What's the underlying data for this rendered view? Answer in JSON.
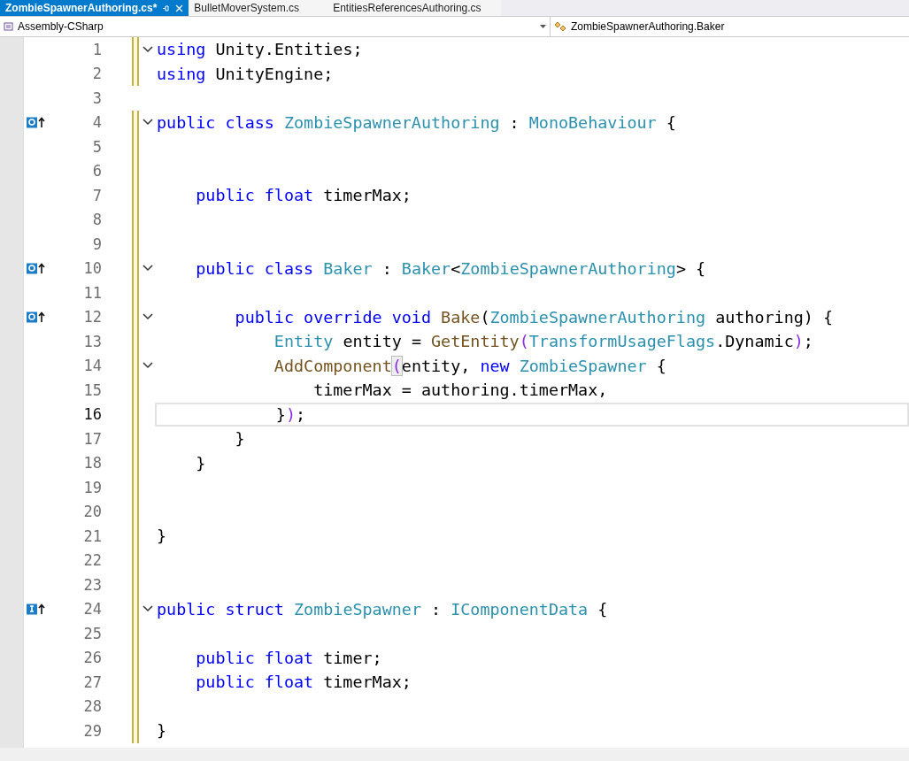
{
  "tabs": [
    {
      "label": "ZombieSpawnerAuthoring.cs*",
      "selected": true
    },
    {
      "label": "BulletMoverSystem.cs",
      "selected": false
    },
    {
      "label": "EntitiesReferencesAuthoring.cs",
      "selected": false
    }
  ],
  "navigation": {
    "project": "Assembly-CSharp",
    "member": "ZombieSpawnerAuthoring.Baker"
  },
  "lines": [
    {
      "number": "1",
      "changed": true,
      "foldable": true,
      "current": false,
      "tokens": [
        {
          "text": "using",
          "kind": "keyword"
        },
        {
          "text": " Unity.Entities;",
          "kind": "plain"
        }
      ]
    },
    {
      "number": "2",
      "changed": true,
      "foldable": false,
      "current": false,
      "tokens": [
        {
          "text": "using",
          "kind": "keyword"
        },
        {
          "text": " UnityEngine;",
          "kind": "plain"
        }
      ]
    },
    {
      "number": "3",
      "changed": false,
      "foldable": false,
      "current": false
    },
    {
      "number": "4",
      "changed": true,
      "foldable": true,
      "current": false,
      "lens": {
        "kind": "class"
      },
      "tokens": [
        {
          "text": "public class ",
          "kind": "keyword"
        },
        {
          "text": "ZombieSpawnerAuthoring",
          "kind": "type"
        },
        {
          "text": " : ",
          "kind": "plain"
        },
        {
          "text": "MonoBehaviour",
          "kind": "type"
        },
        {
          "text": " {",
          "kind": "plain"
        }
      ]
    },
    {
      "number": "5",
      "changed": true,
      "foldable": false,
      "current": false
    },
    {
      "number": "6",
      "changed": true,
      "foldable": false,
      "current": false
    },
    {
      "number": "7",
      "changed": true,
      "foldable": false,
      "current": false,
      "tokens": [
        {
          "text": "    public float",
          "kind": "keyword"
        },
        {
          "text": " timerMax;",
          "kind": "plain"
        }
      ]
    },
    {
      "number": "8",
      "changed": true,
      "foldable": false,
      "current": false
    },
    {
      "number": "9",
      "changed": true,
      "foldable": false,
      "current": false
    },
    {
      "number": "10",
      "changed": true,
      "foldable": true,
      "current": false,
      "lens": {
        "kind": "class"
      },
      "tokens": [
        {
          "text": "    public class ",
          "kind": "keyword"
        },
        {
          "text": "Baker",
          "kind": "type"
        },
        {
          "text": " : ",
          "kind": "plain"
        },
        {
          "text": "Baker",
          "kind": "type"
        },
        {
          "text": "<",
          "kind": "plain"
        },
        {
          "text": "ZombieSpawnerAuthoring",
          "kind": "type"
        },
        {
          "text": "> {",
          "kind": "plain"
        }
      ]
    },
    {
      "number": "11",
      "changed": true,
      "foldable": false,
      "current": false
    },
    {
      "number": "12",
      "changed": true,
      "foldable": true,
      "current": false,
      "lens": {
        "kind": "class"
      },
      "tokens": [
        {
          "text": "        public override void ",
          "kind": "keyword"
        },
        {
          "text": "Bake",
          "kind": "method"
        },
        {
          "text": "(",
          "kind": "plain"
        },
        {
          "text": "ZombieSpawnerAuthoring",
          "kind": "type"
        },
        {
          "text": " authoring) {",
          "kind": "plain"
        }
      ]
    },
    {
      "number": "13",
      "changed": true,
      "foldable": false,
      "current": false,
      "tokens": [
        {
          "text": "            Entity",
          "kind": "type"
        },
        {
          "text": " entity = ",
          "kind": "plain"
        },
        {
          "text": "GetEntity",
          "kind": "method"
        },
        {
          "text": "(",
          "kind": "paren"
        },
        {
          "text": "TransformUsageFlags",
          "kind": "type"
        },
        {
          "text": ".Dynamic",
          "kind": "plain"
        },
        {
          "text": ")",
          "kind": "paren"
        },
        {
          "text": ";",
          "kind": "plain"
        }
      ]
    },
    {
      "number": "14",
      "changed": true,
      "foldable": true,
      "current": false,
      "tokens": [
        {
          "text": "            AddComponent",
          "kind": "method"
        },
        {
          "text": "(",
          "kind": "matched"
        },
        {
          "text": "entity, ",
          "kind": "plain"
        },
        {
          "text": "new ",
          "kind": "keyword"
        },
        {
          "text": "ZombieSpawner",
          "kind": "type"
        },
        {
          "text": " {",
          "kind": "plain"
        }
      ]
    },
    {
      "number": "15",
      "changed": true,
      "foldable": false,
      "current": false,
      "tokens": [
        {
          "text": "                timerMax = authoring.timerMax,",
          "kind": "plain"
        }
      ]
    },
    {
      "number": "16",
      "changed": true,
      "foldable": false,
      "current": true,
      "tokens": [
        {
          "text": "            }",
          "kind": "plain"
        },
        {
          "text": ")",
          "kind": "paren"
        },
        {
          "text": ";",
          "kind": "plain"
        }
      ]
    },
    {
      "number": "17",
      "changed": true,
      "foldable": false,
      "current": false,
      "tokens": [
        {
          "text": "        }",
          "kind": "plain"
        }
      ]
    },
    {
      "number": "18",
      "changed": true,
      "foldable": false,
      "current": false,
      "tokens": [
        {
          "text": "    }",
          "kind": "plain"
        }
      ]
    },
    {
      "number": "19",
      "changed": true,
      "foldable": false,
      "current": false
    },
    {
      "number": "20",
      "changed": true,
      "foldable": false,
      "current": false
    },
    {
      "number": "21",
      "changed": true,
      "foldable": false,
      "current": false,
      "tokens": [
        {
          "text": "}",
          "kind": "plain"
        }
      ]
    },
    {
      "number": "22",
      "changed": true,
      "foldable": false,
      "current": false
    },
    {
      "number": "23",
      "changed": true,
      "foldable": false,
      "current": false
    },
    {
      "number": "24",
      "changed": true,
      "foldable": true,
      "current": false,
      "lens": {
        "kind": "interface"
      },
      "tokens": [
        {
          "text": "public struct ",
          "kind": "keyword"
        },
        {
          "text": "ZombieSpawner",
          "kind": "type"
        },
        {
          "text": " : ",
          "kind": "plain"
        },
        {
          "text": "IComponentData",
          "kind": "type"
        },
        {
          "text": " {",
          "kind": "plain"
        }
      ]
    },
    {
      "number": "25",
      "changed": true,
      "foldable": false,
      "current": false
    },
    {
      "number": "26",
      "changed": true,
      "foldable": false,
      "current": false,
      "tokens": [
        {
          "text": "    public float",
          "kind": "keyword"
        },
        {
          "text": " timer;",
          "kind": "plain"
        }
      ]
    },
    {
      "number": "27",
      "changed": true,
      "foldable": false,
      "current": false,
      "tokens": [
        {
          "text": "    public float",
          "kind": "keyword"
        },
        {
          "text": " timerMax;",
          "kind": "plain"
        }
      ]
    },
    {
      "number": "28",
      "changed": true,
      "foldable": false,
      "current": false
    },
    {
      "number": "29",
      "changed": true,
      "foldable": false,
      "current": false,
      "tokens": [
        {
          "text": "}",
          "kind": "plain"
        }
      ]
    }
  ]
}
